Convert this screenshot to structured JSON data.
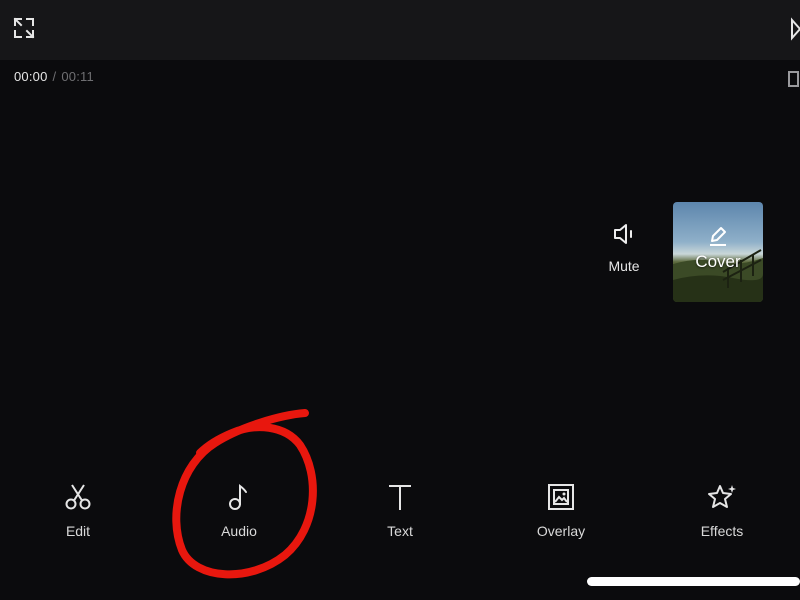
{
  "player": {
    "current_time": "00:00",
    "separator": "/",
    "total_time": "00:11"
  },
  "side_actions": {
    "mute_label": "Mute",
    "cover_label": "Cover"
  },
  "toolbar": {
    "items": [
      {
        "label": "Edit",
        "icon": "scissors-icon"
      },
      {
        "label": "Audio",
        "icon": "music-note-icon"
      },
      {
        "label": "Text",
        "icon": "text-t-icon"
      },
      {
        "label": "Overlay",
        "icon": "overlay-image-icon"
      },
      {
        "label": "Effects",
        "icon": "star-sparkle-icon"
      }
    ]
  },
  "colors": {
    "background": "#0b0b0d",
    "top_bar": "#161618",
    "annotation": "#e8170e",
    "text_muted": "#6f6f72"
  }
}
